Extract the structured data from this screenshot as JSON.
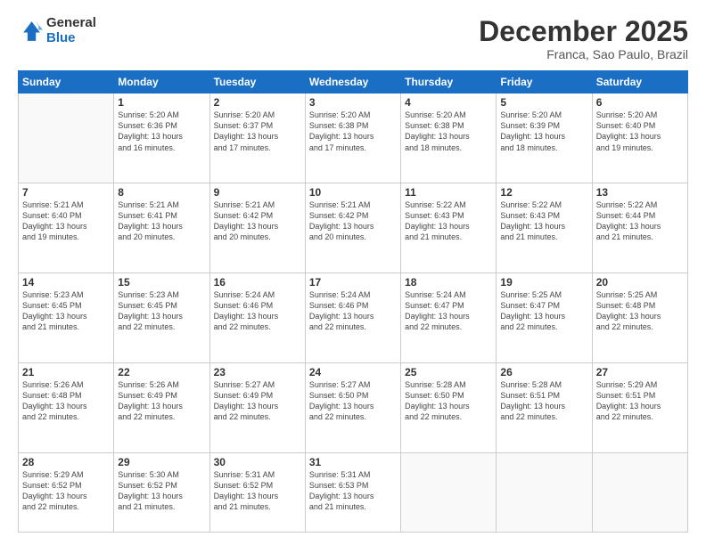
{
  "logo": {
    "general": "General",
    "blue": "Blue"
  },
  "title": "December 2025",
  "location": "Franca, Sao Paulo, Brazil",
  "headers": [
    "Sunday",
    "Monday",
    "Tuesday",
    "Wednesday",
    "Thursday",
    "Friday",
    "Saturday"
  ],
  "weeks": [
    [
      {
        "day": "",
        "empty": true
      },
      {
        "day": "1",
        "sunrise": "5:20 AM",
        "sunset": "6:36 PM",
        "daylight": "13 hours and 16 minutes."
      },
      {
        "day": "2",
        "sunrise": "5:20 AM",
        "sunset": "6:37 PM",
        "daylight": "13 hours and 17 minutes."
      },
      {
        "day": "3",
        "sunrise": "5:20 AM",
        "sunset": "6:38 PM",
        "daylight": "13 hours and 17 minutes."
      },
      {
        "day": "4",
        "sunrise": "5:20 AM",
        "sunset": "6:38 PM",
        "daylight": "13 hours and 18 minutes."
      },
      {
        "day": "5",
        "sunrise": "5:20 AM",
        "sunset": "6:39 PM",
        "daylight": "13 hours and 18 minutes."
      },
      {
        "day": "6",
        "sunrise": "5:20 AM",
        "sunset": "6:40 PM",
        "daylight": "13 hours and 19 minutes."
      }
    ],
    [
      {
        "day": "7",
        "sunrise": "5:21 AM",
        "sunset": "6:40 PM",
        "daylight": "13 hours and 19 minutes."
      },
      {
        "day": "8",
        "sunrise": "5:21 AM",
        "sunset": "6:41 PM",
        "daylight": "13 hours and 20 minutes."
      },
      {
        "day": "9",
        "sunrise": "5:21 AM",
        "sunset": "6:42 PM",
        "daylight": "13 hours and 20 minutes."
      },
      {
        "day": "10",
        "sunrise": "5:21 AM",
        "sunset": "6:42 PM",
        "daylight": "13 hours and 20 minutes."
      },
      {
        "day": "11",
        "sunrise": "5:22 AM",
        "sunset": "6:43 PM",
        "daylight": "13 hours and 21 minutes."
      },
      {
        "day": "12",
        "sunrise": "5:22 AM",
        "sunset": "6:43 PM",
        "daylight": "13 hours and 21 minutes."
      },
      {
        "day": "13",
        "sunrise": "5:22 AM",
        "sunset": "6:44 PM",
        "daylight": "13 hours and 21 minutes."
      }
    ],
    [
      {
        "day": "14",
        "sunrise": "5:23 AM",
        "sunset": "6:45 PM",
        "daylight": "13 hours and 21 minutes."
      },
      {
        "day": "15",
        "sunrise": "5:23 AM",
        "sunset": "6:45 PM",
        "daylight": "13 hours and 22 minutes."
      },
      {
        "day": "16",
        "sunrise": "5:24 AM",
        "sunset": "6:46 PM",
        "daylight": "13 hours and 22 minutes."
      },
      {
        "day": "17",
        "sunrise": "5:24 AM",
        "sunset": "6:46 PM",
        "daylight": "13 hours and 22 minutes."
      },
      {
        "day": "18",
        "sunrise": "5:24 AM",
        "sunset": "6:47 PM",
        "daylight": "13 hours and 22 minutes."
      },
      {
        "day": "19",
        "sunrise": "5:25 AM",
        "sunset": "6:47 PM",
        "daylight": "13 hours and 22 minutes."
      },
      {
        "day": "20",
        "sunrise": "5:25 AM",
        "sunset": "6:48 PM",
        "daylight": "13 hours and 22 minutes."
      }
    ],
    [
      {
        "day": "21",
        "sunrise": "5:26 AM",
        "sunset": "6:48 PM",
        "daylight": "13 hours and 22 minutes."
      },
      {
        "day": "22",
        "sunrise": "5:26 AM",
        "sunset": "6:49 PM",
        "daylight": "13 hours and 22 minutes."
      },
      {
        "day": "23",
        "sunrise": "5:27 AM",
        "sunset": "6:49 PM",
        "daylight": "13 hours and 22 minutes."
      },
      {
        "day": "24",
        "sunrise": "5:27 AM",
        "sunset": "6:50 PM",
        "daylight": "13 hours and 22 minutes."
      },
      {
        "day": "25",
        "sunrise": "5:28 AM",
        "sunset": "6:50 PM",
        "daylight": "13 hours and 22 minutes."
      },
      {
        "day": "26",
        "sunrise": "5:28 AM",
        "sunset": "6:51 PM",
        "daylight": "13 hours and 22 minutes."
      },
      {
        "day": "27",
        "sunrise": "5:29 AM",
        "sunset": "6:51 PM",
        "daylight": "13 hours and 22 minutes."
      }
    ],
    [
      {
        "day": "28",
        "sunrise": "5:29 AM",
        "sunset": "6:52 PM",
        "daylight": "13 hours and 22 minutes."
      },
      {
        "day": "29",
        "sunrise": "5:30 AM",
        "sunset": "6:52 PM",
        "daylight": "13 hours and 21 minutes."
      },
      {
        "day": "30",
        "sunrise": "5:31 AM",
        "sunset": "6:52 PM",
        "daylight": "13 hours and 21 minutes."
      },
      {
        "day": "31",
        "sunrise": "5:31 AM",
        "sunset": "6:53 PM",
        "daylight": "13 hours and 21 minutes."
      },
      {
        "day": "",
        "empty": true
      },
      {
        "day": "",
        "empty": true
      },
      {
        "day": "",
        "empty": true
      }
    ]
  ]
}
